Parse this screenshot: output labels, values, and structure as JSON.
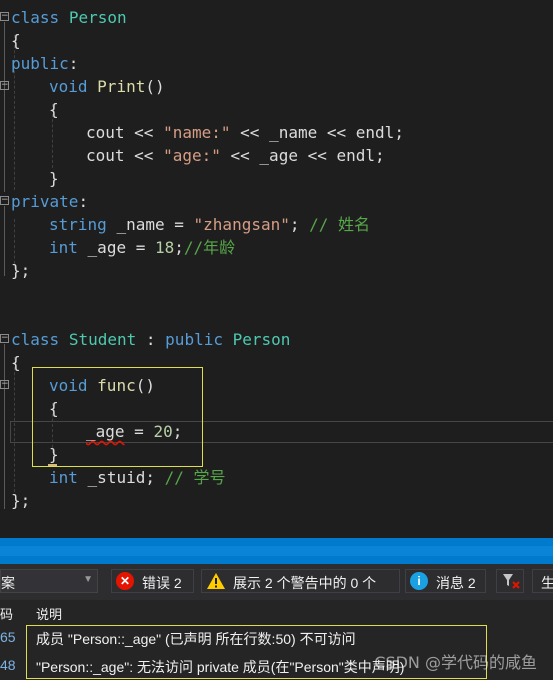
{
  "code": {
    "person_keyword": "class",
    "person_name": "Person",
    "open_brace": "{",
    "public_label": "public",
    "colon": ":",
    "void_kw": "void",
    "print_name": "Print",
    "parens": "()",
    "cout": "cout",
    "shift": "<<",
    "str_name": "\"name:\"",
    "member_name": "_name",
    "endl": "endl",
    "semi": ";",
    "str_age": "\"age:\"",
    "member_age": "_age",
    "close_brace": "}",
    "private_label": "private",
    "string_type": "string",
    "eq": "=",
    "str_zhangsan": "\"zhangsan\"",
    "comment_name": "// 姓名",
    "int_kw": "int",
    "num_18": "18",
    "comment_age": "//年龄",
    "close_class": "};",
    "student_kw": "class",
    "student_name": "Student",
    "inherit_colon": ":",
    "inherit_public": "public",
    "inherit_base": "Person",
    "func_name": "func",
    "num_20": "20",
    "stuid": "_stuid",
    "comment_stuid": "// 学号"
  },
  "toolbar": {
    "scope_text": "案",
    "errors_label": "错误 2",
    "warnings_label": "展示 2 个警告中的 0 个",
    "messages_label": "消息 2",
    "build_label": "生"
  },
  "list_header": {
    "code_col": "码",
    "desc_col": "说明"
  },
  "errors": [
    {
      "code": "65",
      "description": "成员 \"Person::_age\" (已声明 所在行数:50) 不可访问"
    },
    {
      "code": "48",
      "description": "\"Person::_age\": 无法访问 private 成员(在\"Person\"类中声明)"
    }
  ],
  "watermark": "CSDN @学代码的咸鱼",
  "colors": {
    "keyword": "#569cd6",
    "type": "#4ec9b0",
    "string": "#d69d85",
    "comment": "#57a64a",
    "number": "#b5cea8",
    "error_icon": "#e51400",
    "warning_icon": "#ffcc00",
    "info_icon": "#1ba1e2",
    "highlight_box": "#dede4b",
    "status_bar": "#007acc"
  }
}
